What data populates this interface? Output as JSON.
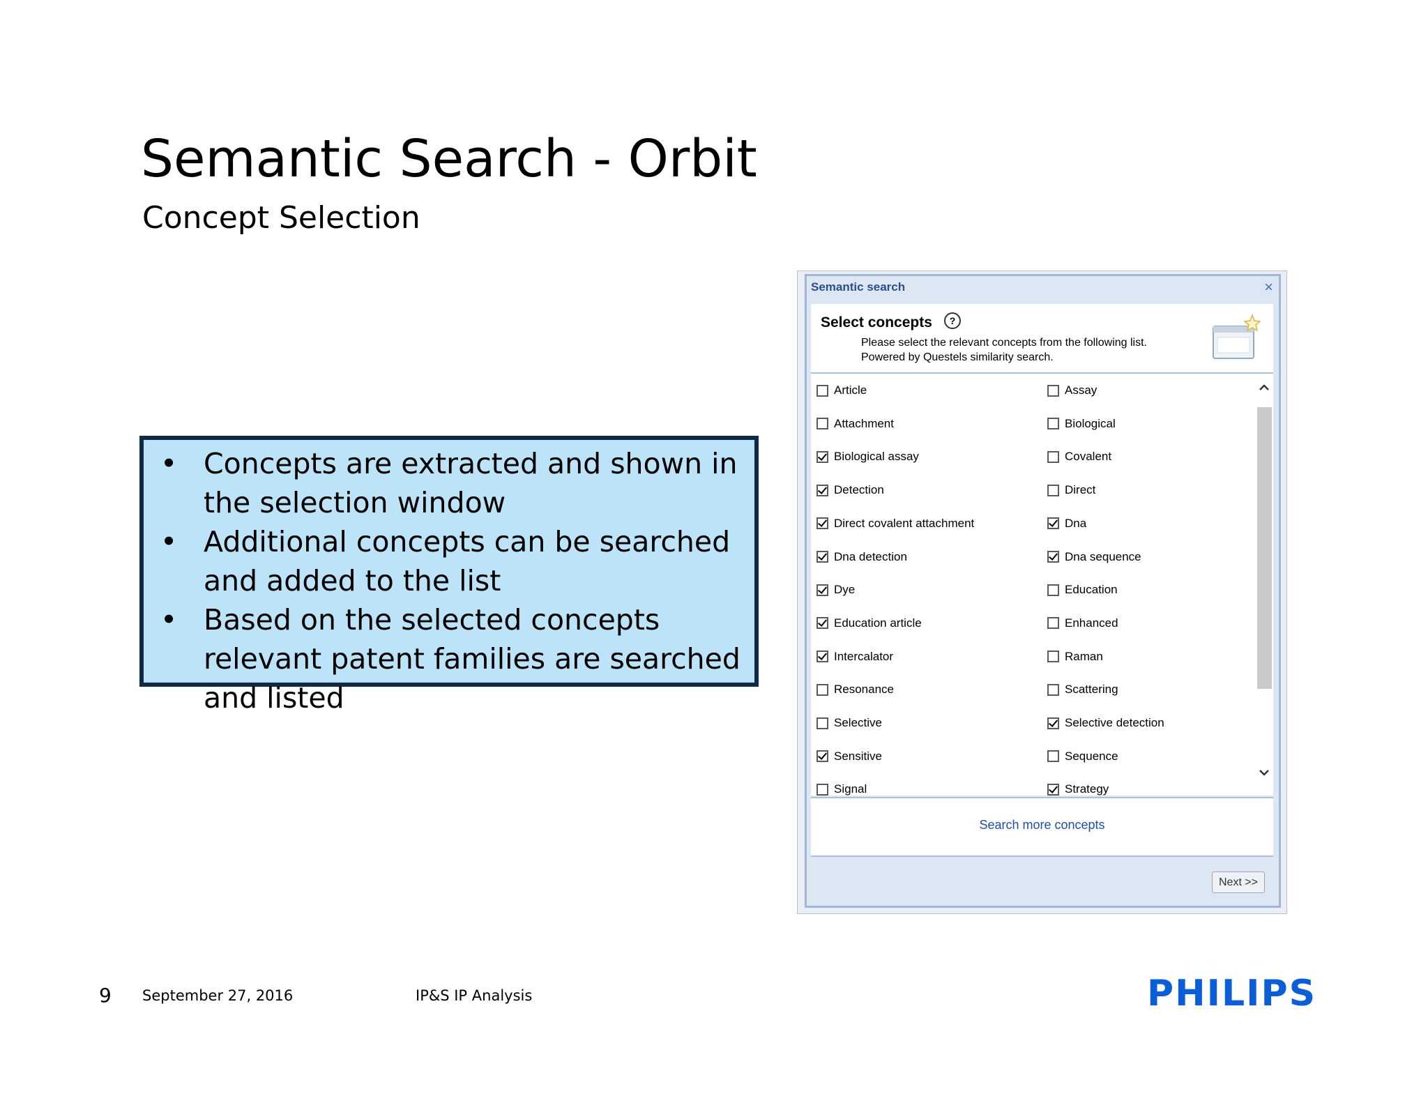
{
  "slide": {
    "title": "Semantic Search - Orbit",
    "subtitle": "Concept Selection"
  },
  "bullets": [
    "Concepts are extracted and shown in the selection window",
    "Additional concepts can be searched and added to the list",
    "Based on the selected concepts relevant patent families are searched and listed"
  ],
  "bullet_symbol": "•",
  "dialog": {
    "title": "Semantic search",
    "close_icon": "×",
    "heading": "Select concepts",
    "help_icon": "?",
    "instruction_line1": "Please select the relevant concepts from the following list.",
    "instruction_line2": "Powered by Questels similarity search.",
    "concepts": [
      {
        "label": "Article",
        "checked": false
      },
      {
        "label": "Assay",
        "checked": false
      },
      {
        "label": "Attachment",
        "checked": false
      },
      {
        "label": "Biological",
        "checked": false
      },
      {
        "label": "Biological assay",
        "checked": true
      },
      {
        "label": "Covalent",
        "checked": false
      },
      {
        "label": "Detection",
        "checked": true
      },
      {
        "label": "Direct",
        "checked": false
      },
      {
        "label": "Direct covalent attachment",
        "checked": true
      },
      {
        "label": "Dna",
        "checked": true
      },
      {
        "label": "Dna detection",
        "checked": true
      },
      {
        "label": "Dna sequence",
        "checked": true
      },
      {
        "label": "Dye",
        "checked": true
      },
      {
        "label": "Education",
        "checked": false
      },
      {
        "label": "Education article",
        "checked": true
      },
      {
        "label": "Enhanced",
        "checked": false
      },
      {
        "label": "Intercalator",
        "checked": true
      },
      {
        "label": "Raman",
        "checked": false
      },
      {
        "label": "Resonance",
        "checked": false
      },
      {
        "label": "Scattering",
        "checked": false
      },
      {
        "label": "Selective",
        "checked": false
      },
      {
        "label": "Selective detection",
        "checked": true
      },
      {
        "label": "Sensitive",
        "checked": true
      },
      {
        "label": "Sequence",
        "checked": false
      },
      {
        "label": "Signal",
        "checked": false
      },
      {
        "label": "Strategy",
        "checked": true
      }
    ],
    "search_more_label": "Search more concepts",
    "next_label": "Next >>"
  },
  "footer": {
    "page_number": "9",
    "date": "September 27, 2016",
    "department": "IP&S IP Analysis",
    "logo_text": "PHILIPS"
  },
  "colors": {
    "bullet_box_bg": "#bde3f8",
    "bullet_box_border": "#0f2a44",
    "logo_blue": "#0b5ed7",
    "link_blue": "#1f4fa8"
  }
}
